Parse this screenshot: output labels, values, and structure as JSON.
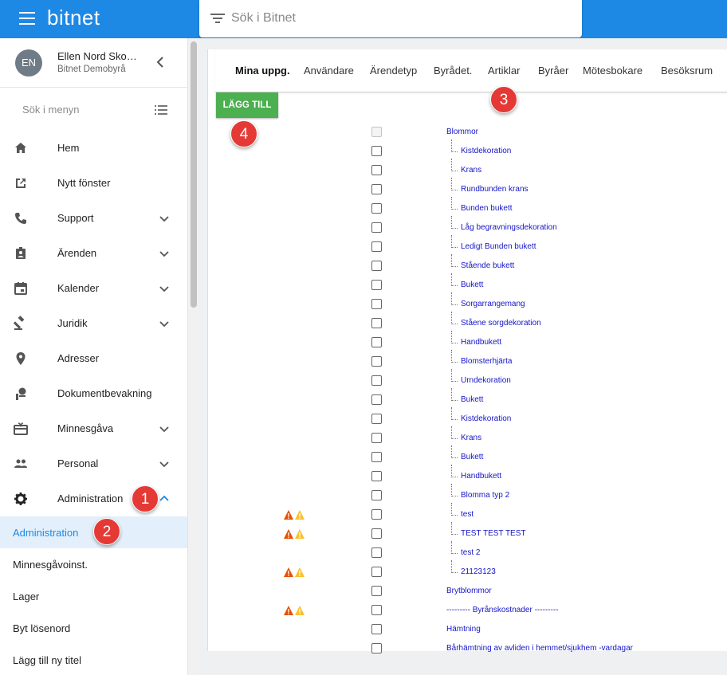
{
  "app": {
    "logo": "bitnet"
  },
  "search": {
    "placeholder": "Sök i Bitnet"
  },
  "user": {
    "initials": "EN",
    "name": "Ellen Nord Sko…",
    "org": "Bitnet Demobyrå"
  },
  "menu_search": {
    "placeholder": "Sök i menyn"
  },
  "nav": [
    {
      "label": "Hem",
      "icon": "home-icon"
    },
    {
      "label": "Nytt fönster",
      "icon": "open-in-new-icon"
    },
    {
      "label": "Support",
      "icon": "phone-icon"
    },
    {
      "label": "Ärenden",
      "icon": "clipboard-account-icon"
    },
    {
      "label": "Kalender",
      "icon": "calendar-icon"
    },
    {
      "label": "Juridik",
      "icon": "gavel-icon"
    },
    {
      "label": "Adresser",
      "icon": "location-pin-icon"
    },
    {
      "label": "Dokumentbevakning",
      "icon": "document-watch-icon"
    },
    {
      "label": "Minnesgåva",
      "icon": "gift-card-icon"
    },
    {
      "label": "Personal",
      "icon": "people-icon"
    },
    {
      "label": "Administration",
      "icon": "gear-icon"
    }
  ],
  "subnav": [
    {
      "label": "Administration",
      "active": true
    },
    {
      "label": "Minnesgåvoinst.",
      "active": false
    },
    {
      "label": "Lager",
      "active": false
    },
    {
      "label": "Byt lösenord",
      "active": false
    },
    {
      "label": "Lägg till ny titel",
      "active": false
    }
  ],
  "tabs": [
    "Mina uppg.",
    "Användare",
    "Ärendetyp",
    "Byrådet.",
    "Artiklar",
    "Byråer",
    "Mötesbokare",
    "Besöksrum"
  ],
  "add_button": "LÄGG TILL",
  "articles": [
    {
      "label": "Blommor",
      "level": 0,
      "warn": false,
      "disabled": true
    },
    {
      "label": "Kistdekoration",
      "level": 1,
      "warn": false
    },
    {
      "label": "Krans",
      "level": 1,
      "warn": false
    },
    {
      "label": "Rundbunden krans",
      "level": 1,
      "warn": false
    },
    {
      "label": "Bunden bukett",
      "level": 1,
      "warn": false
    },
    {
      "label": "Låg begravningsdekoration",
      "level": 1,
      "warn": false
    },
    {
      "label": "Ledigt Bunden bukett",
      "level": 1,
      "warn": false
    },
    {
      "label": "Stående bukett",
      "level": 1,
      "warn": false
    },
    {
      "label": "Bukett",
      "level": 1,
      "warn": false
    },
    {
      "label": "Sorgarrangemang",
      "level": 1,
      "warn": false
    },
    {
      "label": "Ståene sorgdekoration",
      "level": 1,
      "warn": false
    },
    {
      "label": "Handbukett",
      "level": 1,
      "warn": false
    },
    {
      "label": "Blomsterhjärta",
      "level": 1,
      "warn": false
    },
    {
      "label": "Urndekoration",
      "level": 1,
      "warn": false
    },
    {
      "label": "Bukett",
      "level": 1,
      "warn": false
    },
    {
      "label": "Kistdekoration",
      "level": 1,
      "warn": false
    },
    {
      "label": "Krans",
      "level": 1,
      "warn": false
    },
    {
      "label": "Bukett",
      "level": 1,
      "warn": false
    },
    {
      "label": "Handbukett",
      "level": 1,
      "warn": false
    },
    {
      "label": "Blomma typ 2",
      "level": 1,
      "warn": false
    },
    {
      "label": "test",
      "level": 1,
      "warn": true
    },
    {
      "label": "TEST TEST TEST",
      "level": 1,
      "warn": true
    },
    {
      "label": "test 2",
      "level": 1,
      "warn": false
    },
    {
      "label": "21123123",
      "level": 1,
      "warn": true
    },
    {
      "label": "Brytblommor",
      "level": 0,
      "warn": false
    },
    {
      "label": "--------- Byrånskostnader ---------",
      "level": 0,
      "warn": true
    },
    {
      "label": "Hämtning",
      "level": 0,
      "warn": false
    },
    {
      "label": "Bårhämtning av avliden i hemmet/sjukhem -vardagar",
      "level": 0,
      "warn": false
    }
  ],
  "callouts": [
    "1",
    "2",
    "3",
    "4"
  ],
  "colors": {
    "primary": "#1e88e5",
    "add_button": "#4caf50",
    "callout": "#e53935",
    "link": "#1515c8"
  }
}
